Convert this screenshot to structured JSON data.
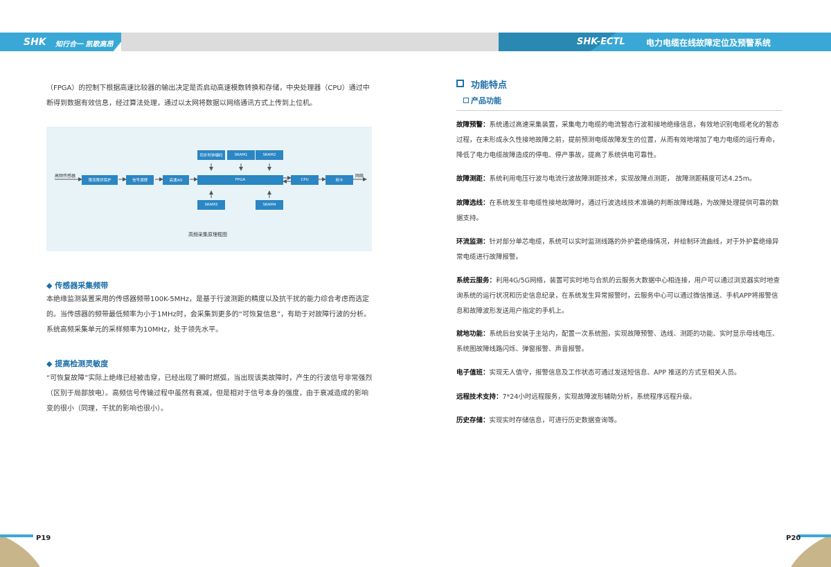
{
  "header": {
    "left_logo": "SHK",
    "left_slogan": "知行合一 凯歌高昂",
    "right_logo": "SHK-ECTL",
    "right_title": "电力电缆在线故障定位及预警系统"
  },
  "left": {
    "intro": "（FPGA）的控制下根据高速比较器的输出决定是否启动高速模数转换和存储，中央处理器（CPU）通过中断得到数据有效信息，经过算法处理，通过以太网将数据以网络通讯方式上传到上位机。",
    "diagram": {
      "caption": "高频采集原理框图",
      "input_label": "高频传感器",
      "output_label": "网络",
      "boxes": {
        "protect": "限流限伏保护",
        "signal": "信号调理",
        "ad": "高速AD",
        "fpga": "FPGA",
        "cpu": "CPU",
        "nic": "网卡",
        "clock": "同步时钟编码",
        "sram1": "SRAM1",
        "sram2": "SRAM2",
        "sram3": "SRAM3",
        "sram4": "SRAM4"
      }
    },
    "section1": {
      "title": "◆ 传感器采集频带",
      "body": "本绝缘监测装置采用的传感器频带100K-5MHz，是基于行波测距的精度以及抗干扰的能力综合考虑而选定的。当传感器的频带最低频率为小于1MHz时，会采集到更多的“可恢复信息”，有助于对故障行波的分析。系统高频采集单元的采样频率为10MHz，处于领先水平。"
    },
    "section2": {
      "title": "◆ 提高检测灵敏度",
      "body": "“可恢复故障”实际上绝缘已经被击穿，已经出现了瞬时燃弧，当出现该类故障时，产生的行波信号非常强烈（区别于局部放电）。高频信号传输过程中虽然有衰减，但是相对于信号本身的强度，由于衰减造成的影响变的很小（同理，干扰的影响也很小）。"
    },
    "page_number": "P19"
  },
  "right": {
    "title": "功能特点",
    "subtitle": "产品功能",
    "features": [
      {
        "label": "故障预警：",
        "text": "系统通过高速采集装置，采集电力电缆的电流暂态行波和接地绝缘信息，有效地识别电缆老化的暂态过程，在未形成永久性接地故障之前，提前预测电缆故障发生的位置，从而有效地增加了电力电缆的运行寿命，降低了电力电缆故障造成的停电、停产事故，提高了系统供电可靠性。"
      },
      {
        "label": "故障测距：",
        "text": "系统利用电压行波与电流行波故障测距技术，实现故障点测距， 故障测距精度可达4.25m。"
      },
      {
        "label": "故障选线：",
        "text": "在系统发生非电缆性接地故障时，通过行波选线技术准确的判断故障线路，为故障处理提供可靠的数据支持。"
      },
      {
        "label": "环流监测：",
        "text": "针对部分单芯电缆，系统可以实时监测线路的外护套绝缘情况，并绘制环流曲线，对于外护套绝缘异常电缆进行故障报警。"
      },
      {
        "label": "系统云服务：",
        "text": "利用4G/5G网络，装置可实时地与合凯的云服务大数据中心相连接，用户可以通过浏览器实时地查询系统的运行状况和历史信息纪录，在系统发生异常报警时，云服务中心可以通过微信推送、手机APP将报警信息和故障波形发送用户指定的手机上。"
      },
      {
        "label": "就地功能：",
        "text": "系统后台安装于主站内，配置一次系统图，实现故障预警、选线、测距的功能、实时显示母线电压、系统图故障线路闪烁、弹窗报警、声音报警。"
      },
      {
        "label": "电子值班：",
        "text": "实现无人值守，报警信息及工作状态可通过发送短信息、APP 推送的方式至相关人员。"
      },
      {
        "label": "远程技术支持：",
        "text": "7*24小时远程服务，实现故障波形辅助分析，系统程序远程升级。"
      },
      {
        "label": "历史存储：",
        "text": "实现实时存储信息，可进行历史数据查询等。"
      }
    ],
    "page_number": "P20"
  }
}
